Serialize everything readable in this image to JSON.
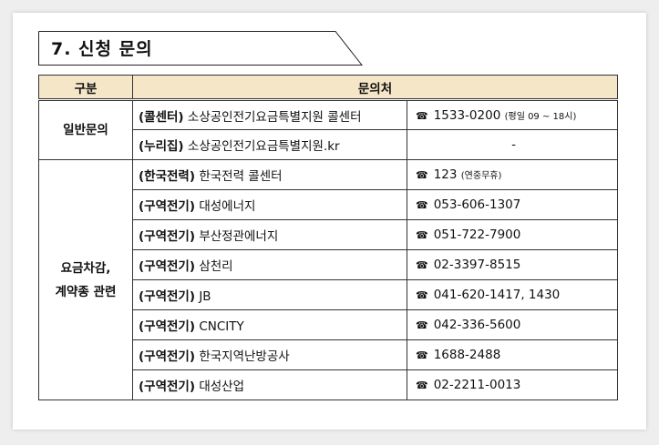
{
  "section": {
    "title": "7. 신청 문의"
  },
  "table": {
    "headers": [
      "구분",
      "문의처"
    ],
    "general": {
      "category": "일반문의",
      "rows": [
        {
          "tag": "(콜센터)",
          "name": "소상공인전기요금특별지원 콜센터",
          "phone": "1533-0200",
          "note": "(평일 09 ~ 18시)"
        },
        {
          "tag": "(누리집)",
          "name": "소상공인전기요금특별지원.kr",
          "phone": "-",
          "note": ""
        }
      ]
    },
    "billing": {
      "category_line1": "요금차감,",
      "category_line2": "계약종 관련",
      "rows": [
        {
          "tag": "(한국전력)",
          "name": "한국전력 콜센터",
          "phone": "123",
          "note": "(연중무휴)"
        },
        {
          "tag": "(구역전기)",
          "name": "대성에너지",
          "phone": "053-606-1307",
          "note": ""
        },
        {
          "tag": "(구역전기)",
          "name": "부산정관에너지",
          "phone": "051-722-7900",
          "note": ""
        },
        {
          "tag": "(구역전기)",
          "name": "삼천리",
          "phone": "02-3397-8515",
          "note": ""
        },
        {
          "tag": "(구역전기)",
          "name": "JB",
          "phone": "041-620-1417, 1430",
          "note": ""
        },
        {
          "tag": "(구역전기)",
          "name": "CNCITY",
          "phone": "042-336-5600",
          "note": ""
        },
        {
          "tag": "(구역전기)",
          "name": "한국지역난방공사",
          "phone": "1688-2488",
          "note": ""
        },
        {
          "tag": "(구역전기)",
          "name": "대성산업",
          "phone": "02-2211-0013",
          "note": ""
        }
      ]
    }
  },
  "icons": {
    "phone": "telephone-icon",
    "phone_glyph": "☎"
  },
  "colors": {
    "header_bg": "#f5e6c8"
  }
}
